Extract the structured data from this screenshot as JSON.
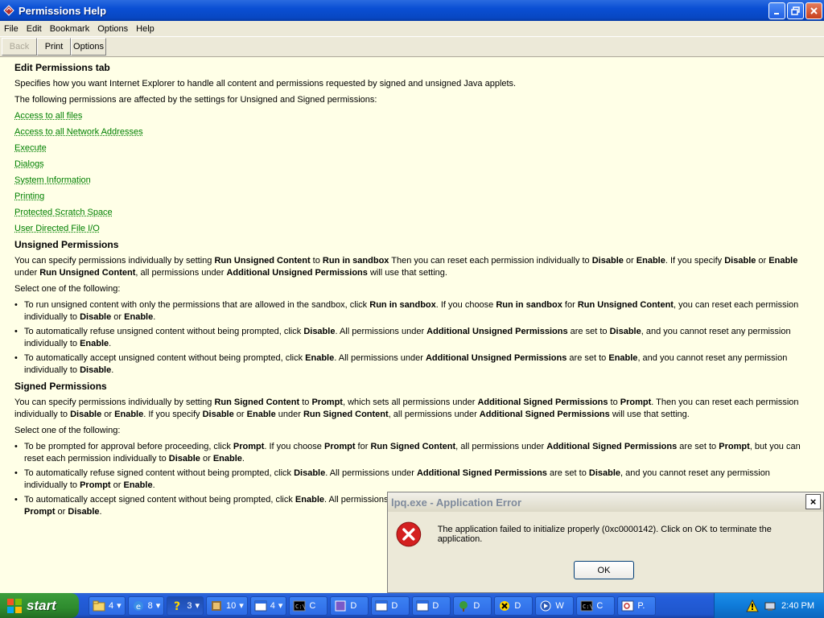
{
  "window": {
    "title": "Permissions Help"
  },
  "menu": [
    "File",
    "Edit",
    "Bookmark",
    "Options",
    "Help"
  ],
  "toolbar": {
    "back": "Back",
    "print": "Print",
    "options": "Options"
  },
  "content": {
    "heading1": "Edit Permissions tab",
    "p1": "Specifies how you want Internet Explorer to handle all content and permissions requested by signed and unsigned Java applets.",
    "p2": "The following permissions are affected by the settings for Unsigned and Signed permissions:",
    "links": [
      "Access to all files",
      "Access to all Network Addresses",
      "Execute",
      "Dialogs",
      "System Information",
      "Printing",
      "Protected Scratch Space",
      "User Directed File I/O"
    ],
    "heading2": "Unsigned Permissions",
    "unsigned_intro": [
      {
        "t": "You can specify permissions individually by setting "
      },
      {
        "b": "Run Unsigned Content"
      },
      {
        "t": " to "
      },
      {
        "b": "Run in sandbox"
      },
      {
        "t": " Then you can reset each permission individually to "
      },
      {
        "b": "Disable"
      },
      {
        "t": " or "
      },
      {
        "b": "Enable"
      },
      {
        "t": ". If you specify "
      },
      {
        "b": "Disable"
      },
      {
        "t": " or "
      },
      {
        "b": "Enable"
      },
      {
        "t": " under "
      },
      {
        "b": "Run Unsigned Content"
      },
      {
        "t": ", all permissions under "
      },
      {
        "b": "Additional Unsigned Permissions"
      },
      {
        "t": " will use that setting."
      }
    ],
    "select1": "Select one of the following:",
    "unsigned_bullets": [
      [
        {
          "t": "To run unsigned content with only the permissions that are allowed in the sandbox, click "
        },
        {
          "b": "Run in sandbox"
        },
        {
          "t": ". If you choose "
        },
        {
          "b": "Run in sandbox"
        },
        {
          "t": " for "
        },
        {
          "b": "Run Unsigned Content"
        },
        {
          "t": ", you can reset each permission individually to "
        },
        {
          "b": "Disable"
        },
        {
          "t": " or "
        },
        {
          "b": "Enable"
        },
        {
          "t": "."
        }
      ],
      [
        {
          "t": "To automatically refuse unsigned content without being prompted, click "
        },
        {
          "b": "Disable"
        },
        {
          "t": ". All permissions under "
        },
        {
          "b": "Additional Unsigned Permissions"
        },
        {
          "t": " are set to "
        },
        {
          "b": "Disable"
        },
        {
          "t": ", and you cannot reset any permission individually to "
        },
        {
          "b": "Enable"
        },
        {
          "t": "."
        }
      ],
      [
        {
          "t": "To automatically accept unsigned content without being prompted, click "
        },
        {
          "b": "Enable"
        },
        {
          "t": ". All permissions under "
        },
        {
          "b": "Additional Unsigned Permissions"
        },
        {
          "t": " are set to "
        },
        {
          "b": "Enable"
        },
        {
          "t": ", and you cannot reset any permission individually to "
        },
        {
          "b": "Disable"
        },
        {
          "t": "."
        }
      ]
    ],
    "heading3": "Signed Permissions",
    "signed_intro": [
      {
        "t": "You can specify permissions individually by setting "
      },
      {
        "b": "Run Signed Content"
      },
      {
        "t": " to "
      },
      {
        "b": "Prompt"
      },
      {
        "t": ", which sets all permissions under "
      },
      {
        "b": "Additional Signed Permissions"
      },
      {
        "t": " to "
      },
      {
        "b": "Prompt"
      },
      {
        "t": ". Then you can reset each permission individually to "
      },
      {
        "b": "Disable"
      },
      {
        "t": " or "
      },
      {
        "b": "Enable"
      },
      {
        "t": ". If you specify "
      },
      {
        "b": "Disable"
      },
      {
        "t": " or "
      },
      {
        "b": "Enable"
      },
      {
        "t": " under "
      },
      {
        "b": "Run Signed Content"
      },
      {
        "t": ", all permissions under "
      },
      {
        "b": "Additional Signed Permissions"
      },
      {
        "t": " will use that setting."
      }
    ],
    "select2": "Select one of the following:",
    "signed_bullets": [
      [
        {
          "t": "To be prompted for approval before proceeding, click "
        },
        {
          "b": "Prompt"
        },
        {
          "t": ". If you choose "
        },
        {
          "b": "Prompt"
        },
        {
          "t": " for "
        },
        {
          "b": "Run Signed Content"
        },
        {
          "t": ", all permissions under "
        },
        {
          "b": "Additional Signed Permissions"
        },
        {
          "t": " are set to "
        },
        {
          "b": "Prompt"
        },
        {
          "t": ", but you can reset each permission individually to "
        },
        {
          "b": "Disable"
        },
        {
          "t": " or "
        },
        {
          "b": "Enable"
        },
        {
          "t": "."
        }
      ],
      [
        {
          "t": "To automatically refuse signed content without being prompted, click "
        },
        {
          "b": "Disable"
        },
        {
          "t": ". All permissions under "
        },
        {
          "b": "Additional Signed Permissions"
        },
        {
          "t": " are set to "
        },
        {
          "b": "Disable"
        },
        {
          "t": ", and you cannot reset any permission individually to "
        },
        {
          "b": "Prompt"
        },
        {
          "t": " or "
        },
        {
          "b": "Enable"
        },
        {
          "t": "."
        }
      ],
      [
        {
          "t": "To automatically accept signed content without being prompted, click "
        },
        {
          "b": "Enable"
        },
        {
          "t": ". All permissions "
        },
        {
          "t": "u"
        }
      ]
    ],
    "signed_bullet3_cont": [
      {
        "b": "Prompt"
      },
      {
        "t": " or "
      },
      {
        "b": "Disable"
      },
      {
        "t": "."
      }
    ]
  },
  "dialog": {
    "title": "lpq.exe - Application Error",
    "close": "×",
    "message": "The application failed to initialize properly (0xc0000142). Click on OK to terminate the application.",
    "ok": "OK"
  },
  "taskbar": {
    "start": "start",
    "buttons": [
      {
        "icon": "folder-icon",
        "label": "4",
        "arrow": "▾"
      },
      {
        "icon": "ie-icon",
        "label": "8",
        "arrow": "▾"
      },
      {
        "icon": "help-icon",
        "label": "3",
        "arrow": "▾",
        "active": true
      },
      {
        "icon": "program-icon",
        "label": "10",
        "arrow": "▾"
      },
      {
        "icon": "window-icon",
        "label": "4",
        "arrow": "▾"
      },
      {
        "icon": "cmd-icon",
        "label": "C"
      },
      {
        "icon": "app-icon",
        "label": "D"
      },
      {
        "icon": "window-icon",
        "label": "D"
      },
      {
        "icon": "window-icon",
        "label": "D"
      },
      {
        "icon": "tree-icon",
        "label": "D"
      },
      {
        "icon": "error-icon",
        "label": "D"
      },
      {
        "icon": "media-icon",
        "label": "W"
      },
      {
        "icon": "cmd-icon",
        "label": "C"
      },
      {
        "icon": "search-window-icon",
        "label": "P."
      }
    ],
    "clock": "2:40 PM"
  }
}
